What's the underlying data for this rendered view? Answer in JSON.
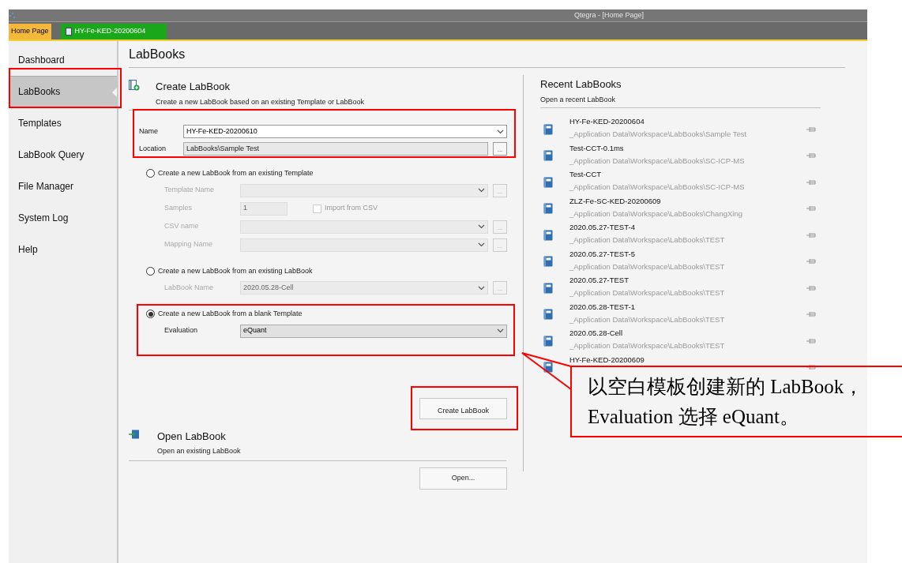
{
  "window": {
    "title": "Qtegra - [Home Page]"
  },
  "tabs": [
    {
      "label": "Home Page",
      "selected": true
    },
    {
      "label": "HY-Fe-KED-20200604",
      "selected": false
    }
  ],
  "sidebar": {
    "items": [
      {
        "label": "Dashboard",
        "selected": false
      },
      {
        "label": "LabBooks",
        "selected": true
      },
      {
        "label": "Templates",
        "selected": false
      },
      {
        "label": "LabBook Query",
        "selected": false
      },
      {
        "label": "File Manager",
        "selected": false
      },
      {
        "label": "System Log",
        "selected": false
      },
      {
        "label": "Help",
        "selected": false
      }
    ]
  },
  "page_title": "LabBooks",
  "create": {
    "title": "Create LabBook",
    "subtitle": "Create a new LabBook based on an existing Template or LabBook",
    "name": {
      "label": "Name",
      "value": "HY-Fe-KED-20200610"
    },
    "location": {
      "label": "Location",
      "value": "LabBooks\\Sample Test",
      "browse": "..."
    },
    "options": [
      {
        "label": "Create a new LabBook from an existing Template",
        "selected": false,
        "fields": [
          {
            "kind": "dropdown",
            "label": "Template Name",
            "browse": "..."
          },
          {
            "kind": "samples",
            "label": "Samples",
            "value": "1",
            "checkbox": {
              "label": "Import from CSV",
              "checked": false
            }
          },
          {
            "kind": "dropdown",
            "label": "CSV name",
            "browse": "..."
          },
          {
            "kind": "dropdown",
            "label": "Mapping Name",
            "browse": "..."
          }
        ]
      },
      {
        "label": "Create a new LabBook from an existing LabBook",
        "selected": false,
        "fields": [
          {
            "kind": "dropdown",
            "label": "LabBook Name",
            "value": "2020.05.28-Cell",
            "browse": "..."
          }
        ]
      },
      {
        "label": "Create a new LabBook from a blank Template",
        "selected": true,
        "fields": [
          {
            "kind": "dropdown",
            "label": "Evaluation",
            "value": "eQuant"
          }
        ]
      }
    ],
    "button": "Create LabBook"
  },
  "open": {
    "title": "Open LabBook",
    "subtitle": "Open an existing LabBook",
    "button": "Open..."
  },
  "recent": {
    "title": "Recent LabBooks",
    "subtitle": "Open a recent LabBook",
    "items": [
      {
        "name": "HY-Fe-KED-20200604",
        "path": "_Application Data\\Workspace\\LabBooks\\Sample Test"
      },
      {
        "name": "Test-CCT-0.1ms",
        "path": "_Application Data\\Workspace\\LabBooks\\SC-ICP-MS"
      },
      {
        "name": "Test-CCT",
        "path": "_Application Data\\Workspace\\LabBooks\\SC-ICP-MS"
      },
      {
        "name": "ZLZ-Fe-SC-KED-20200609",
        "path": "_Application Data\\Workspace\\LabBooks\\ChangXing"
      },
      {
        "name": "2020.05.27-TEST-4",
        "path": "_Application Data\\Workspace\\LabBooks\\TEST"
      },
      {
        "name": "2020.05.27-TEST-5",
        "path": "_Application Data\\Workspace\\LabBooks\\TEST"
      },
      {
        "name": "2020.05.27-TEST",
        "path": "_Application Data\\Workspace\\LabBooks\\TEST"
      },
      {
        "name": "2020.05.28-TEST-1",
        "path": "_Application Data\\Workspace\\LabBooks\\TEST"
      },
      {
        "name": "2020.05.28-Cell",
        "path": "_Application Data\\Workspace\\LabBooks\\TEST"
      },
      {
        "name": "HY-Fe-KED-20200609"
      }
    ]
  },
  "annotation": {
    "text": "以空白模板创建新的 LabBook，Evaluation 选择 eQuant。"
  }
}
